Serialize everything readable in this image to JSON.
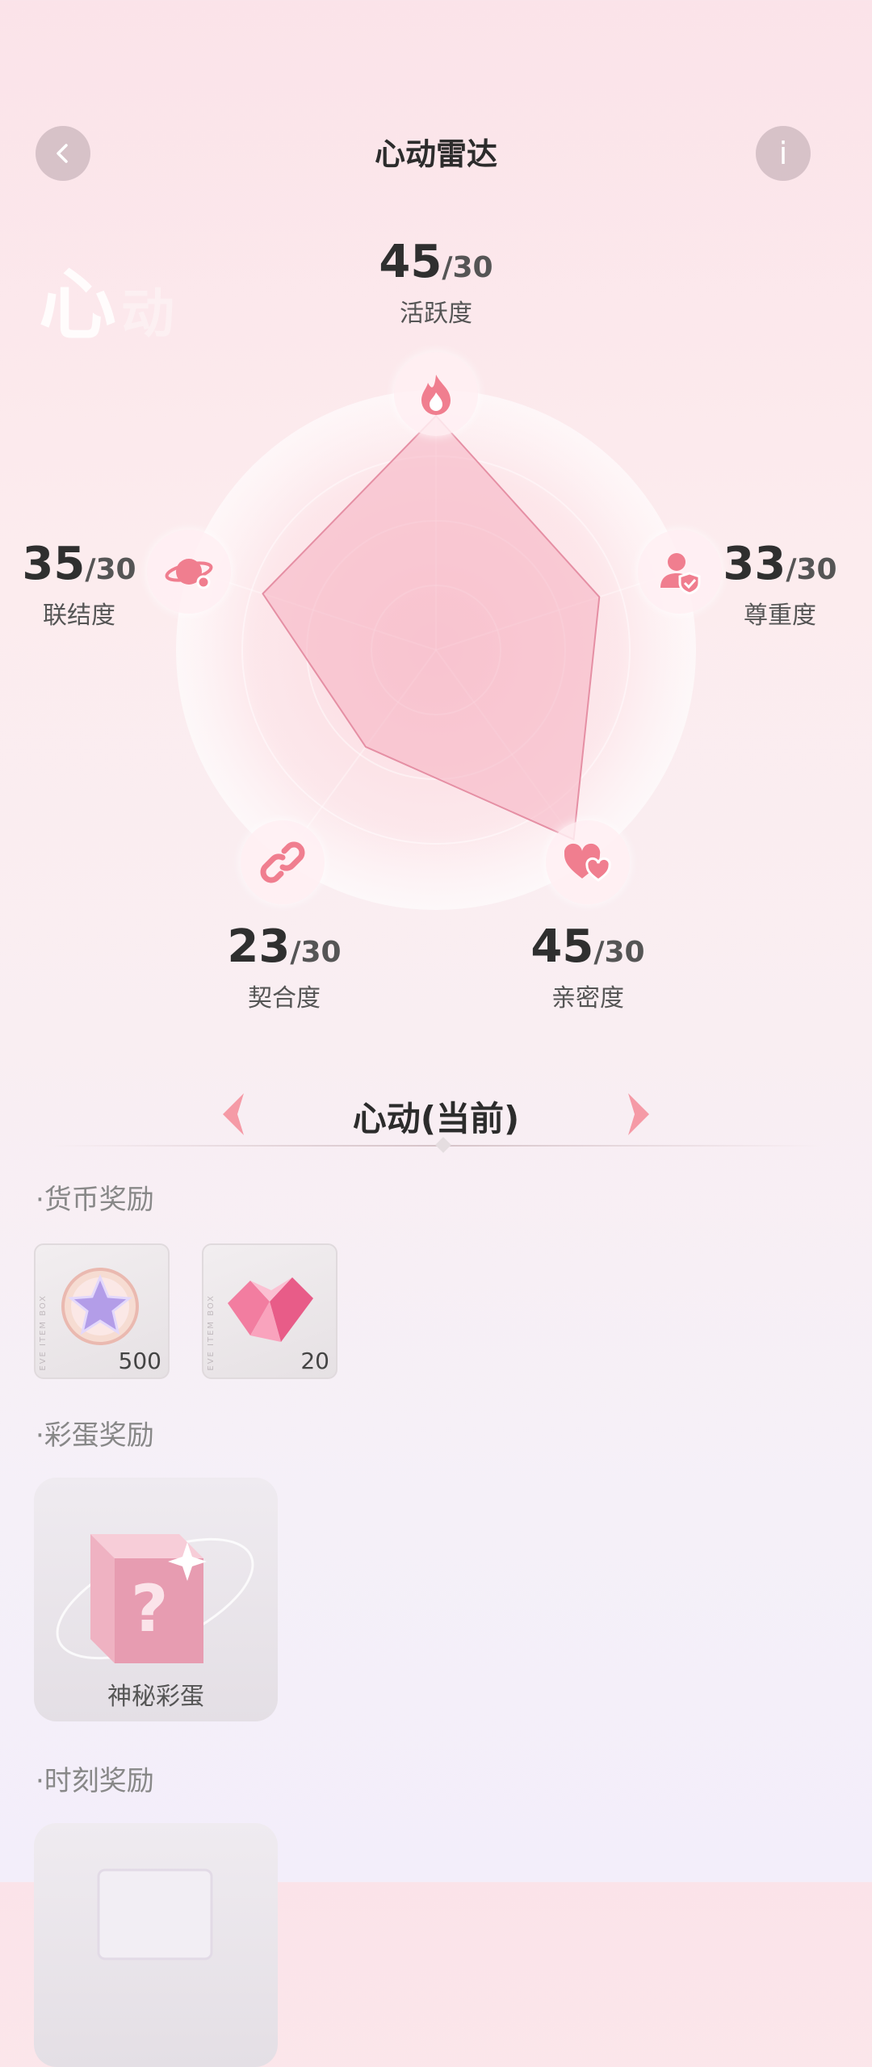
{
  "header": {
    "title": "心动雷达",
    "back_icon": "chevron-left-icon",
    "info_icon": "info-icon",
    "info_glyph": "i"
  },
  "watermark": {
    "main": "心",
    "faded": "动"
  },
  "radar": {
    "stats": [
      {
        "key": "activity",
        "label": "活跃度",
        "value": "45",
        "max": "/30",
        "icon": "flame-icon"
      },
      {
        "key": "respect",
        "label": "尊重度",
        "value": "33",
        "max": "/30",
        "icon": "user-shield-icon"
      },
      {
        "key": "intimacy",
        "label": "亲密度",
        "value": "45",
        "max": "/30",
        "icon": "hearts-icon"
      },
      {
        "key": "fit",
        "label": "契合度",
        "value": "23",
        "max": "/30",
        "icon": "link-icon"
      },
      {
        "key": "connection",
        "label": "联结度",
        "value": "35",
        "max": "/30",
        "icon": "planet-icon"
      }
    ],
    "colors": {
      "fill": "#f6b6c4",
      "stroke": "#e58fa4",
      "accent": "#f07e8f"
    }
  },
  "level": {
    "title": "心动(当前)",
    "prev_icon": "arrow-left-icon",
    "next_icon": "arrow-right-icon"
  },
  "sections": {
    "currency": {
      "title": "·货币奖励",
      "items": [
        {
          "icon": "star-coin-icon",
          "count": "500"
        },
        {
          "icon": "pink-crystal-icon",
          "count": "20"
        }
      ]
    },
    "easter_egg": {
      "title": "·彩蛋奖励",
      "items": [
        {
          "icon": "mystery-box-icon",
          "caption": "神秘彩蛋"
        }
      ]
    },
    "moment": {
      "title": "·时刻奖励",
      "items": [
        {
          "icon": "moment-card-icon"
        }
      ]
    }
  }
}
